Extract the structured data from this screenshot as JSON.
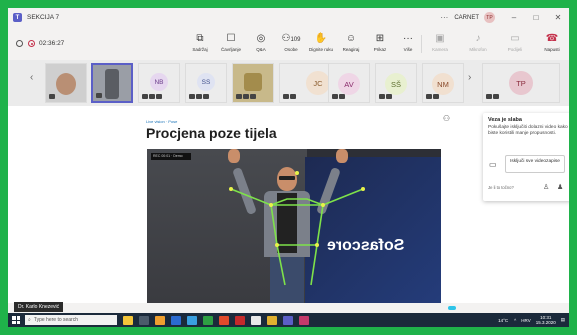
{
  "window": {
    "title": "SEKCIJA 7",
    "more": "···",
    "org": "CARNET",
    "user_initials": "TP",
    "min": "–",
    "max": "□",
    "close": "✕"
  },
  "toolbar": {
    "timer": "02:36:27",
    "buttons": [
      {
        "label": "Sadržaj",
        "icon": "share-icon"
      },
      {
        "label": "Čavrljanje",
        "icon": "chat-icon"
      },
      {
        "label": "Q&A",
        "icon": "qa-icon"
      },
      {
        "label": "Osobe",
        "icon": "people-icon",
        "count": "109"
      },
      {
        "label": "Dignite ruku",
        "icon": "hand-icon"
      },
      {
        "label": "Reagiraj",
        "icon": "emoji-icon"
      },
      {
        "label": "Prikaz",
        "icon": "grid-icon"
      },
      {
        "label": "Više",
        "icon": "more-icon"
      },
      {
        "label": "Kamera",
        "icon": "camera-icon"
      },
      {
        "label": "Mikrofon",
        "icon": "mic-icon"
      },
      {
        "label": "Podijeli",
        "icon": "share-screen-icon"
      },
      {
        "label": "Napusti",
        "icon": "leave-icon"
      }
    ]
  },
  "participants": [
    {
      "initials": "",
      "type": "video"
    },
    {
      "initials": "",
      "type": "video",
      "active": true
    },
    {
      "initials": "NB",
      "color": "#e6d7ef"
    },
    {
      "initials": "SS",
      "color": "#dfe3f2"
    },
    {
      "initials": "",
      "type": "video"
    },
    {
      "initials": "JC",
      "color": "#f1e1d1"
    },
    {
      "initials": "AV",
      "color": "#efd6e6"
    },
    {
      "initials": "SŠ",
      "color": "#e8f0d0"
    },
    {
      "initials": "NM",
      "color": "#f1e0d0"
    },
    {
      "initials": "TP",
      "color": "#e8c7cf"
    }
  ],
  "slide": {
    "small": "Live vision · Pose",
    "title": "Procjena poze tijela",
    "hud": "REC  00:01  · Demo"
  },
  "speaker": {
    "name": "Dr. Karlo Knezević",
    "banner": "Sofascore"
  },
  "toast": {
    "title": "Veza je slaba",
    "body": "Pokušajte isključiti dolazni video kako biste koristili manje propusnosti.",
    "button": "Isključi sve videozapise",
    "hint": "Je li to točno?"
  },
  "taskbar": {
    "search_placeholder": "Type here to search",
    "temp": "14°C",
    "lang": "HRV",
    "time": "10:31",
    "date": "15.3.2020"
  }
}
